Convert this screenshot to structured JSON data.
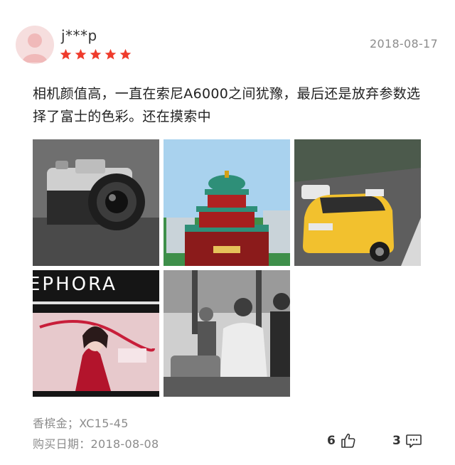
{
  "user": {
    "name": "j***p",
    "rating": 5
  },
  "date": "2018-08-17",
  "review_text": "相机颜值高，一直在索尼A6000之间犹豫，最后还是放弃参数选择了富士的色彩。还在摸索中",
  "photos": [
    {
      "name": "camera-photo"
    },
    {
      "name": "building-photo"
    },
    {
      "name": "taxi-photo"
    },
    {
      "name": "sephora-photo",
      "sign_text": "EPHORA"
    },
    {
      "name": "street-photo"
    }
  ],
  "meta": {
    "variant": "香槟金；XC15-45",
    "purchase_date": "购买日期：2018-08-08"
  },
  "actions": {
    "likes": "6",
    "comments": "3"
  },
  "colors": {
    "star": "#ef3b2c",
    "muted": "#8c8c8c",
    "taxi": "#f2c12e"
  }
}
